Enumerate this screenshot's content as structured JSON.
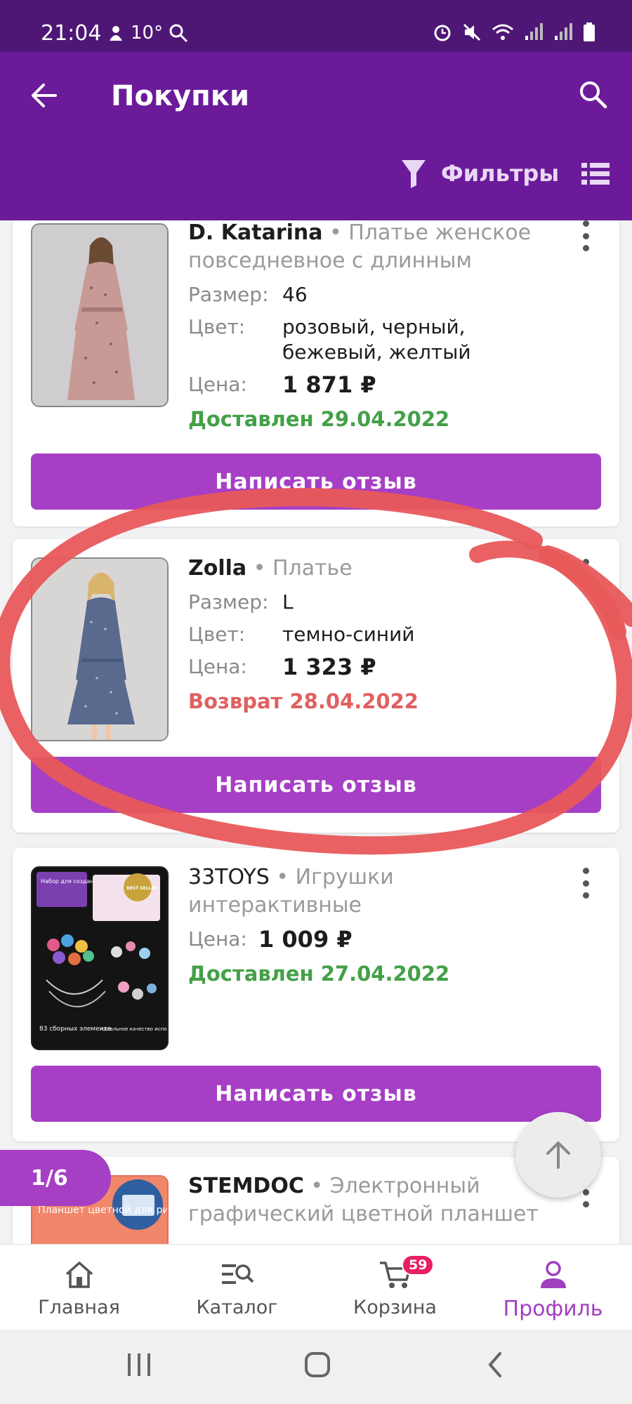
{
  "status_bar": {
    "time": "21:04",
    "temperature": "10°"
  },
  "app_bar": {
    "title": "Покупки",
    "filters_label": "Фильтры"
  },
  "purchases": [
    {
      "brand": "D. Katarina",
      "name": "Платье женское повседневное с длинным",
      "size_label": "Размер:",
      "size": "46",
      "color_label": "Цвет:",
      "color": "розовый, черный, бежевый, желтый",
      "price_label": "Цена:",
      "price": "1 871 ₽",
      "status": "Доставлен 29.04.2022",
      "status_type": "delivered",
      "review_button": "Написать отзыв"
    },
    {
      "brand": "Zolla",
      "name": "Платье",
      "size_label": "Размер:",
      "size": "L",
      "color_label": "Цвет:",
      "color": "темно-синий",
      "price_label": "Цена:",
      "price": "1 323 ₽",
      "status": "Возврат 28.04.2022",
      "status_type": "return",
      "review_button": "Написать отзыв"
    },
    {
      "brand": "33TOYS",
      "name": "Игрушки интерактивные",
      "price_label": "Цена:",
      "price": "1 009 ₽",
      "status": "Доставлен 27.04.2022",
      "status_type": "delivered",
      "review_button": "Написать отзыв",
      "thumb_texts": [
        "Набор для создания украшений",
        "BEST SELLER",
        "83 сборных элемента",
        "Идеальное качество исполнения"
      ]
    },
    {
      "brand": "STEMDOC",
      "name": "Электронный графический цветной планшет",
      "thumb_text": "Планшет цветной для рисования"
    }
  ],
  "page_indicator": "1/6",
  "bottom_nav": [
    {
      "label": "Главная",
      "icon": "home-icon"
    },
    {
      "label": "Каталог",
      "icon": "catalog-search-icon"
    },
    {
      "label": "Корзина",
      "icon": "cart-icon",
      "badge": "59"
    },
    {
      "label": "Профиль",
      "icon": "profile-icon",
      "active": true
    }
  ],
  "colors": {
    "status_bar": "#4f1775",
    "app_bar": "#6b1b9a",
    "accent": "#a63fc5",
    "delivered": "#43a047",
    "return": "#e06060",
    "annotation": "#e8585a"
  }
}
